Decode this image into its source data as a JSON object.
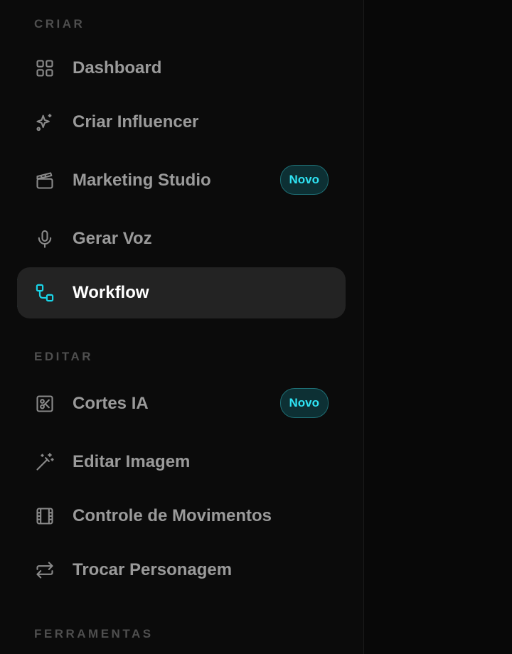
{
  "sections": {
    "criar": "CRIAR",
    "editar": "EDITAR",
    "ferramentas": "FERRAMENTAS"
  },
  "items": {
    "dashboard": {
      "label": "Dashboard",
      "icon": "grid-icon"
    },
    "criar_influencer": {
      "label": "Criar Influencer",
      "icon": "sparkles-icon"
    },
    "marketing_studio": {
      "label": "Marketing Studio",
      "icon": "clapperboard-icon",
      "badge": "Novo"
    },
    "gerar_voz": {
      "label": "Gerar Voz",
      "icon": "microphone-icon"
    },
    "workflow": {
      "label": "Workflow",
      "icon": "workflow-icon",
      "active": true
    },
    "cortes_ia": {
      "label": "Cortes IA",
      "icon": "scissors-square-icon",
      "badge": "Novo"
    },
    "editar_imagem": {
      "label": "Editar Imagem",
      "icon": "magic-wand-icon"
    },
    "controle_movimentos": {
      "label": "Controle de Movimentos",
      "icon": "film-icon"
    },
    "trocar_personagem": {
      "label": "Trocar Personagem",
      "icon": "swap-arrows-icon"
    }
  },
  "colors": {
    "accent": "#19d3e6",
    "badge_text": "#2fe3f3",
    "label": "#9a9a9a",
    "active_label": "#ffffff",
    "section_title": "#4f4f4f"
  }
}
